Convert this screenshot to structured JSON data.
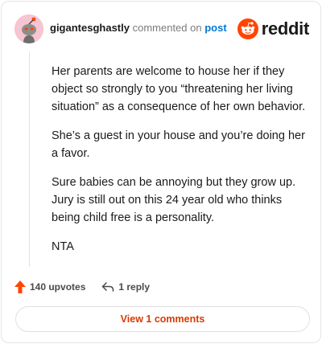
{
  "comment": {
    "username": "gigantesghastly",
    "action_text": "commented on",
    "post_link": "post",
    "paragraphs": [
      "Her parents are welcome to house her if they object so strongly to you “threatening her living situation” as a consequence of her own behavior.",
      "She’s a guest in your house and you’re doing her a favor.",
      "Sure babies can be annoying but they grow up. Jury is still out on this 24 year old who thinks being child free is a personality.",
      "NTA"
    ]
  },
  "brand": {
    "name": "reddit",
    "icon": "reddit-snoo-icon",
    "color": "#ff4500"
  },
  "actions": {
    "upvotes": "140 upvotes",
    "upvote_icon": "upvote-arrow-icon",
    "reply": "1 reply",
    "reply_icon": "reply-arrow-icon"
  },
  "view_button": {
    "label": "View 1 comments",
    "color": "#d93a00"
  }
}
